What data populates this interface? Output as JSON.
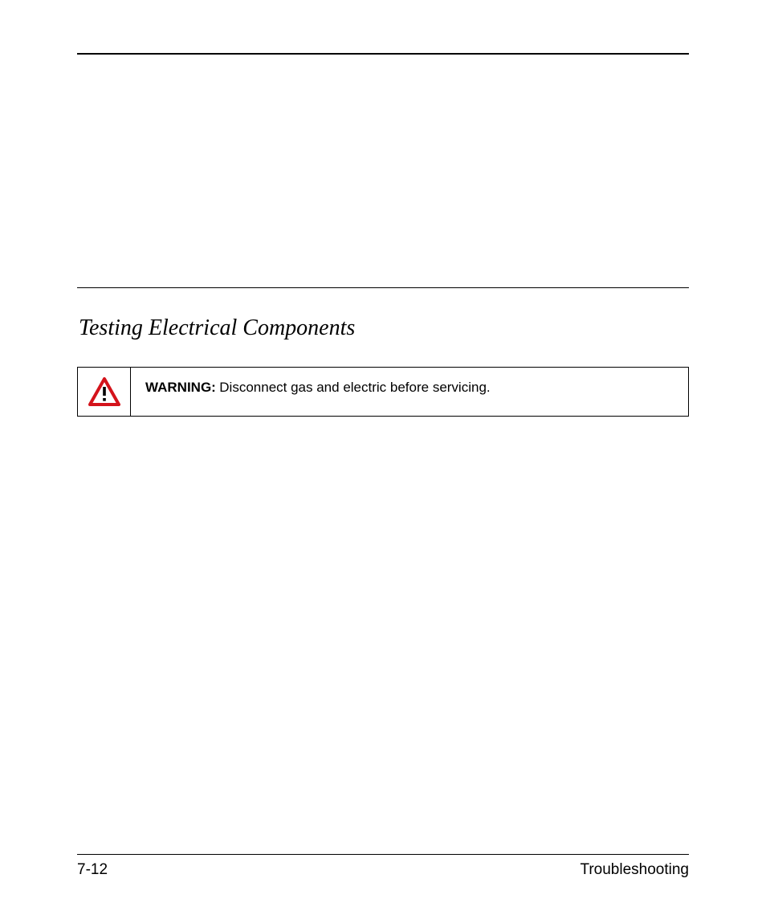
{
  "header": {},
  "section": {
    "title": "Testing Electrical Components"
  },
  "callout": {
    "icon": "warning-triangle",
    "heading": "WARNING:",
    "text": "Disconnect gas and electric before servicing."
  },
  "footer": {
    "page": "7-12",
    "chapter": "Troubleshooting"
  }
}
